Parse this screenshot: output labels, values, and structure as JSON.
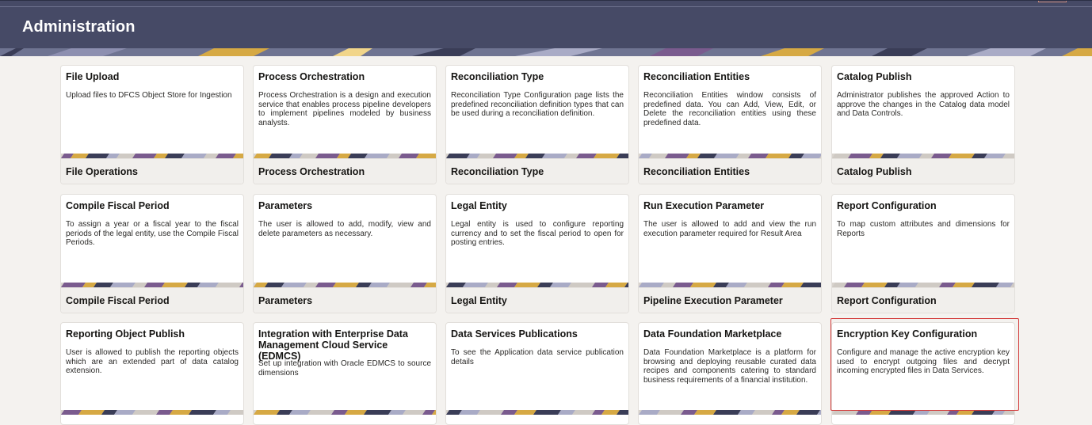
{
  "header": {
    "title": "Administration"
  },
  "tiles": [
    {
      "title": "File Upload",
      "desc": "Upload files to DFCS Object Store for Ingestion",
      "foot": "File Operations"
    },
    {
      "title": "Process Orchestration",
      "desc": "Process Orchestration is a design and execution service that enables process pipeline developers to implement pipelines modeled by business analysts.",
      "foot": "Process Orchestration"
    },
    {
      "title": "Reconciliation Type",
      "desc": "Reconciliation Type Configuration page lists the predefined reconciliation definition types that can be used during a reconciliation definition.",
      "foot": "Reconciliation Type"
    },
    {
      "title": "Reconciliation Entities",
      "desc": "Reconciliation Entities window consists of predefined data. You can Add, View, Edit, or Delete the reconciliation entities using these predefined data.",
      "foot": "Reconciliation Entities"
    },
    {
      "title": "Catalog Publish",
      "desc": "Administrator publishes the approved Action to approve the changes in the Catalog data model and Data Controls.",
      "foot": "Catalog Publish"
    },
    {
      "title": "Compile Fiscal Period",
      "desc": "To assign a year or a fiscal year to the fiscal periods of the legal entity, use the Compile Fiscal Periods.",
      "foot": "Compile Fiscal Period"
    },
    {
      "title": "Parameters",
      "desc": "The user is allowed to add, modify, view and delete parameters as necessary.",
      "foot": "Parameters"
    },
    {
      "title": "Legal Entity",
      "desc": "Legal entity is used to configure reporting currency and to set the fiscal period to open for posting entries.",
      "foot": "Legal Entity"
    },
    {
      "title": "Run Execution Parameter",
      "desc": "The user is allowed to add and view the run execution parameter required for Result Area",
      "foot": "Pipeline Execution Parameter"
    },
    {
      "title": "Report Configuration",
      "desc": "To map custom attributes and dimensions for Reports",
      "foot": "Report Configuration"
    },
    {
      "title": "Reporting Object Publish",
      "desc": "User is allowed to publish the reporting objects which are an extended part of data catalog extension.",
      "foot": ""
    },
    {
      "title": "Integration with Enterprise Data Management Cloud Service (EDMCS)",
      "desc": "Set up integration with Oracle EDMCS to source dimensions",
      "foot": ""
    },
    {
      "title": "Data Services Publications",
      "desc": "To see the Application data service publication details",
      "foot": ""
    },
    {
      "title": "Data Foundation Marketplace",
      "desc": "Data Foundation Marketplace is a platform for browsing and deploying reusable curated data recipes and components catering to standard business requirements of a financial institution.",
      "foot": ""
    },
    {
      "title": "Encryption Key Configuration",
      "desc": "Configure and manage the active encryption key used to encrypt outgoing files and decrypt incoming encrypted files in Data Services.",
      "foot": ""
    }
  ],
  "colors": {
    "header_bg": "#464a66",
    "accent_purple": "#7a5b8e",
    "accent_gold": "#d6a944",
    "selected_border": "#d33a3a"
  }
}
